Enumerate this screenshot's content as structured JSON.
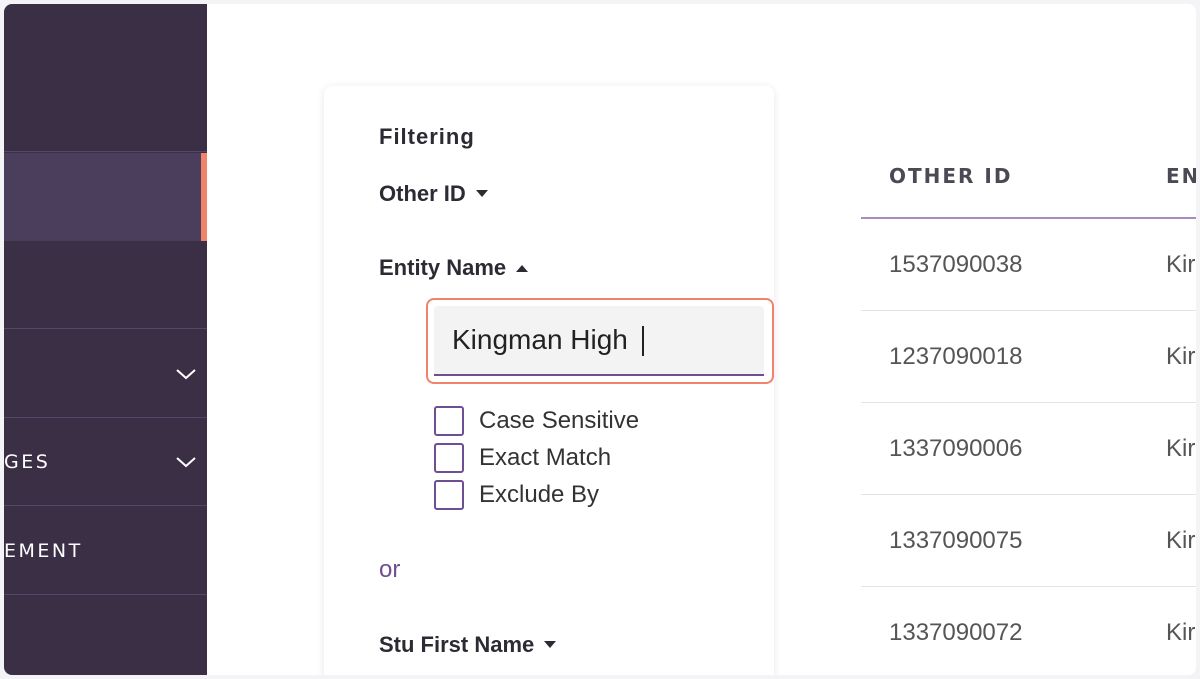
{
  "sidebar": {
    "items": [
      {
        "label": ""
      },
      {
        "label": ""
      },
      {
        "label": ""
      },
      {
        "label": ""
      },
      {
        "label": "GES"
      },
      {
        "label": "EMENT"
      },
      {
        "label": ""
      }
    ]
  },
  "filter": {
    "title": "Filtering",
    "other_id": "Other ID",
    "entity_name": "Entity Name",
    "search_value": "Kingman High",
    "options": [
      "Case Sensitive",
      "Exact Match",
      "Exclude By"
    ],
    "or_label": "or",
    "stu_first_name": "Stu First Name"
  },
  "table": {
    "columns": [
      "OTHER ID",
      "EN"
    ],
    "rows": [
      {
        "other_id": "1537090038",
        "entity": "Kir"
      },
      {
        "other_id": "1237090018",
        "entity": "Kir"
      },
      {
        "other_id": "1337090006",
        "entity": "Kir"
      },
      {
        "other_id": "1337090075",
        "entity": "Kir"
      },
      {
        "other_id": "1337090072",
        "entity": "Kir"
      }
    ]
  },
  "colors": {
    "sidebar_bg": "#3a2f45",
    "accent": "#f0836a",
    "purple": "#6e4f93"
  },
  "icons": {
    "expand": "chevron-down-icon",
    "sort_down": "caret-down-icon",
    "sort_up": "caret-up-icon"
  }
}
